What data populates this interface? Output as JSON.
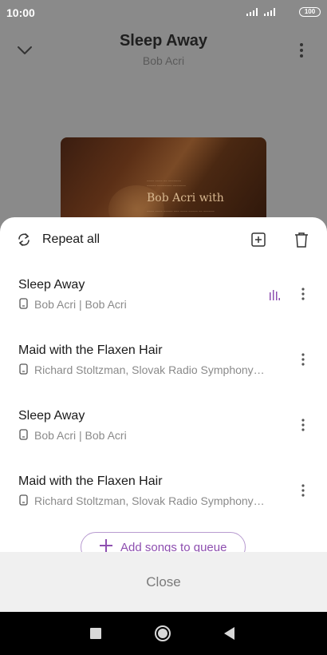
{
  "status_bar": {
    "time": "10:00",
    "battery": "100"
  },
  "player": {
    "title": "Sleep Away",
    "artist": "Bob Acri",
    "album_art_text": "Bob Acri with"
  },
  "queue": {
    "repeat_label": "Repeat all",
    "items": [
      {
        "title": "Sleep Away",
        "subtitle": "Bob Acri | Bob Acri",
        "playing": true
      },
      {
        "title": "Maid with the Flaxen Hair",
        "subtitle": "Richard Stoltzman, Slovak Radio Symphony…",
        "playing": false
      },
      {
        "title": "Sleep Away",
        "subtitle": "Bob Acri | Bob Acri",
        "playing": false
      },
      {
        "title": "Maid with the Flaxen Hair",
        "subtitle": "Richard Stoltzman, Slovak Radio Symphony…",
        "playing": false
      }
    ],
    "add_songs_label": "Add songs to queue",
    "close_label": "Close"
  },
  "colors": {
    "accent": "#8e4fb0",
    "dim_overlay": "#8a8a8a",
    "sheet_bg": "#ffffff",
    "close_bar_bg": "#f0f0f0"
  },
  "icons": {
    "repeat": "repeat-icon",
    "add_to_playlist": "add-to-playlist-icon",
    "delete": "trash-icon",
    "playing": "equalizer-icon",
    "more": "more-vertical-icon",
    "device": "phone-device-icon"
  }
}
